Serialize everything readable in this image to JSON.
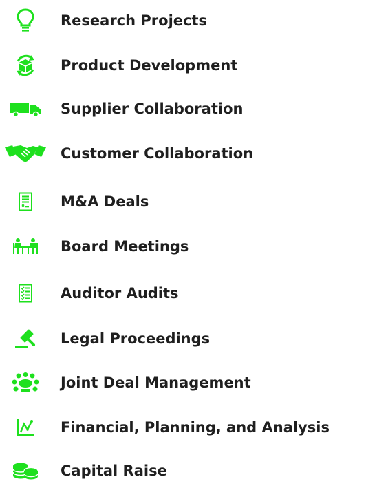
{
  "accent_color": "#1ee01e",
  "items": [
    {
      "label": "Research Projects",
      "icon": "lightbulb-icon"
    },
    {
      "label": "Product Development",
      "icon": "box-cycle-icon"
    },
    {
      "label": "Supplier Collaboration",
      "icon": "truck-icon"
    },
    {
      "label": "Customer Collaboration",
      "icon": "handshake-icon"
    },
    {
      "label": "M&A Deals",
      "icon": "contract-document-icon"
    },
    {
      "label": "Board Meetings",
      "icon": "meeting-table-icon"
    },
    {
      "label": "Auditor Audits",
      "icon": "checklist-icon"
    },
    {
      "label": "Legal Proceedings",
      "icon": "gavel-icon"
    },
    {
      "label": "Joint Deal Management",
      "icon": "round-table-icon"
    },
    {
      "label": "Financial, Planning, and Analysis",
      "icon": "line-chart-icon"
    },
    {
      "label": "Capital Raise",
      "icon": "coin-stack-icon"
    }
  ]
}
